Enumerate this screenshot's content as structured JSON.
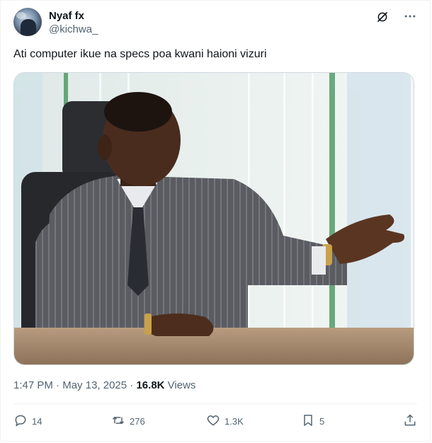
{
  "tweet": {
    "author_name": "Nyaf fx",
    "author_handle": "@kichwa_",
    "text": "Ati computer ikue na specs poa kwani haioni vizuri",
    "time": "1:47 PM",
    "date": "May 13, 2025",
    "separator": "·",
    "views_count": "16.8K",
    "views_label": "Views"
  },
  "actions": {
    "replies": "14",
    "reposts": "276",
    "likes": "1.3K",
    "bookmarks": "5"
  },
  "icons": {
    "grok": "grok-icon",
    "more": "more-icon",
    "reply": "reply-icon",
    "repost": "repost-icon",
    "like": "heart-icon",
    "bookmark": "bookmark-icon",
    "share": "share-icon"
  },
  "colors": {
    "text_primary": "#0f1419",
    "text_secondary": "#536471",
    "border": "#eff3f4"
  }
}
